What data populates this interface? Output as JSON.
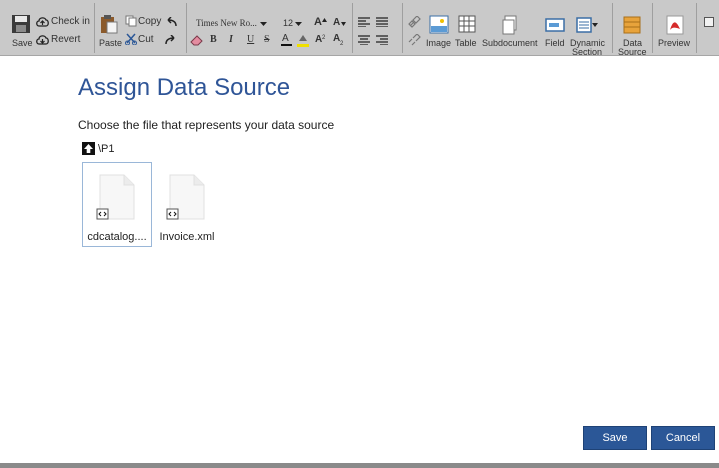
{
  "toolbar": {
    "save": "Save",
    "check_in": "Check in",
    "revert": "Revert",
    "paste": "Paste",
    "copy": "Copy",
    "cut": "Cut",
    "font_name": "Times New Ro...",
    "font_size": "12",
    "bold": "B",
    "italic": "I",
    "underline": "U",
    "strike": "S",
    "font_color": "A",
    "grow_font": "A",
    "shrink_font": "A",
    "superscript": "A",
    "subscript": "A",
    "image": "Image",
    "table": "Table",
    "subdocument": "Subdocument",
    "field": "Field",
    "dynamic_section_1": "Dynamic",
    "dynamic_section_2": "Section",
    "data_source_1": "Data",
    "data_source_2": "Source",
    "preview": "Preview"
  },
  "dialog": {
    "title": "Assign Data Source",
    "subtitle": "Choose the file that represents your data source",
    "path": "\\P1",
    "files": [
      {
        "name": "cdcatalog....",
        "selected": true
      },
      {
        "name": "Invoice.xml",
        "selected": false
      }
    ],
    "save_label": "Save",
    "cancel_label": "Cancel"
  },
  "colors": {
    "ribbon_bg": "#c9c9c9",
    "title_blue": "#2f5597",
    "button_blue": "#2b5797",
    "selection_border": "#9ab7d8"
  }
}
